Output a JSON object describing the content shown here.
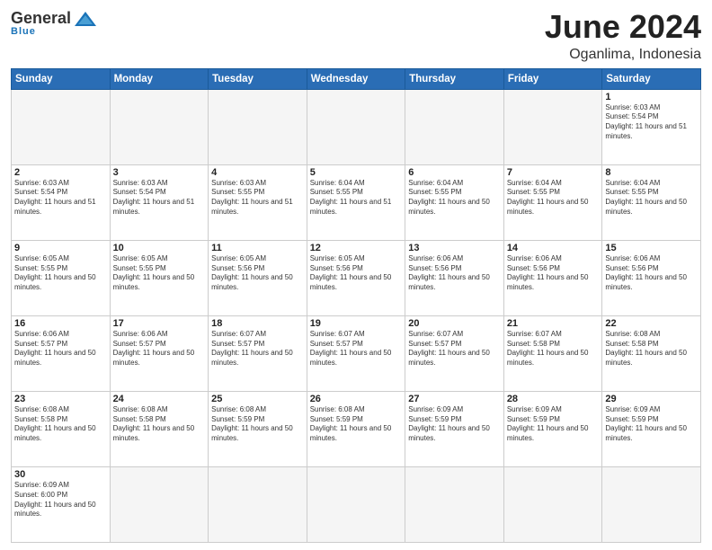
{
  "logo": {
    "general": "General",
    "blue": "Blue",
    "sub": "Blue"
  },
  "title": {
    "month": "June 2024",
    "location": "Oganlima, Indonesia"
  },
  "weekdays": [
    "Sunday",
    "Monday",
    "Tuesday",
    "Wednesday",
    "Thursday",
    "Friday",
    "Saturday"
  ],
  "weeks": [
    [
      {
        "day": "",
        "empty": true
      },
      {
        "day": "",
        "empty": true
      },
      {
        "day": "",
        "empty": true
      },
      {
        "day": "",
        "empty": true
      },
      {
        "day": "",
        "empty": true
      },
      {
        "day": "",
        "empty": true
      },
      {
        "day": "1",
        "sunrise": "6:03 AM",
        "sunset": "5:54 PM",
        "daylight": "11 hours and 51 minutes."
      }
    ],
    [
      {
        "day": "2",
        "sunrise": "6:03 AM",
        "sunset": "5:54 PM",
        "daylight": "11 hours and 51 minutes."
      },
      {
        "day": "3",
        "sunrise": "6:03 AM",
        "sunset": "5:54 PM",
        "daylight": "11 hours and 51 minutes."
      },
      {
        "day": "4",
        "sunrise": "6:03 AM",
        "sunset": "5:55 PM",
        "daylight": "11 hours and 51 minutes."
      },
      {
        "day": "5",
        "sunrise": "6:04 AM",
        "sunset": "5:55 PM",
        "daylight": "11 hours and 51 minutes."
      },
      {
        "day": "6",
        "sunrise": "6:04 AM",
        "sunset": "5:55 PM",
        "daylight": "11 hours and 50 minutes."
      },
      {
        "day": "7",
        "sunrise": "6:04 AM",
        "sunset": "5:55 PM",
        "daylight": "11 hours and 50 minutes."
      },
      {
        "day": "8",
        "sunrise": "6:04 AM",
        "sunset": "5:55 PM",
        "daylight": "11 hours and 50 minutes."
      }
    ],
    [
      {
        "day": "9",
        "sunrise": "6:05 AM",
        "sunset": "5:55 PM",
        "daylight": "11 hours and 50 minutes."
      },
      {
        "day": "10",
        "sunrise": "6:05 AM",
        "sunset": "5:55 PM",
        "daylight": "11 hours and 50 minutes."
      },
      {
        "day": "11",
        "sunrise": "6:05 AM",
        "sunset": "5:56 PM",
        "daylight": "11 hours and 50 minutes."
      },
      {
        "day": "12",
        "sunrise": "6:05 AM",
        "sunset": "5:56 PM",
        "daylight": "11 hours and 50 minutes."
      },
      {
        "day": "13",
        "sunrise": "6:06 AM",
        "sunset": "5:56 PM",
        "daylight": "11 hours and 50 minutes."
      },
      {
        "day": "14",
        "sunrise": "6:06 AM",
        "sunset": "5:56 PM",
        "daylight": "11 hours and 50 minutes."
      },
      {
        "day": "15",
        "sunrise": "6:06 AM",
        "sunset": "5:56 PM",
        "daylight": "11 hours and 50 minutes."
      }
    ],
    [
      {
        "day": "16",
        "sunrise": "6:06 AM",
        "sunset": "5:57 PM",
        "daylight": "11 hours and 50 minutes."
      },
      {
        "day": "17",
        "sunrise": "6:06 AM",
        "sunset": "5:57 PM",
        "daylight": "11 hours and 50 minutes."
      },
      {
        "day": "18",
        "sunrise": "6:07 AM",
        "sunset": "5:57 PM",
        "daylight": "11 hours and 50 minutes."
      },
      {
        "day": "19",
        "sunrise": "6:07 AM",
        "sunset": "5:57 PM",
        "daylight": "11 hours and 50 minutes."
      },
      {
        "day": "20",
        "sunrise": "6:07 AM",
        "sunset": "5:57 PM",
        "daylight": "11 hours and 50 minutes."
      },
      {
        "day": "21",
        "sunrise": "6:07 AM",
        "sunset": "5:58 PM",
        "daylight": "11 hours and 50 minutes."
      },
      {
        "day": "22",
        "sunrise": "6:08 AM",
        "sunset": "5:58 PM",
        "daylight": "11 hours and 50 minutes."
      }
    ],
    [
      {
        "day": "23",
        "sunrise": "6:08 AM",
        "sunset": "5:58 PM",
        "daylight": "11 hours and 50 minutes."
      },
      {
        "day": "24",
        "sunrise": "6:08 AM",
        "sunset": "5:58 PM",
        "daylight": "11 hours and 50 minutes."
      },
      {
        "day": "25",
        "sunrise": "6:08 AM",
        "sunset": "5:59 PM",
        "daylight": "11 hours and 50 minutes."
      },
      {
        "day": "26",
        "sunrise": "6:08 AM",
        "sunset": "5:59 PM",
        "daylight": "11 hours and 50 minutes."
      },
      {
        "day": "27",
        "sunrise": "6:09 AM",
        "sunset": "5:59 PM",
        "daylight": "11 hours and 50 minutes."
      },
      {
        "day": "28",
        "sunrise": "6:09 AM",
        "sunset": "5:59 PM",
        "daylight": "11 hours and 50 minutes."
      },
      {
        "day": "29",
        "sunrise": "6:09 AM",
        "sunset": "5:59 PM",
        "daylight": "11 hours and 50 minutes."
      }
    ],
    [
      {
        "day": "30",
        "sunrise": "6:09 AM",
        "sunset": "6:00 PM",
        "daylight": "11 hours and 50 minutes."
      },
      {
        "day": "",
        "empty": true
      },
      {
        "day": "",
        "empty": true
      },
      {
        "day": "",
        "empty": true
      },
      {
        "day": "",
        "empty": true
      },
      {
        "day": "",
        "empty": true
      },
      {
        "day": "",
        "empty": true
      }
    ]
  ]
}
